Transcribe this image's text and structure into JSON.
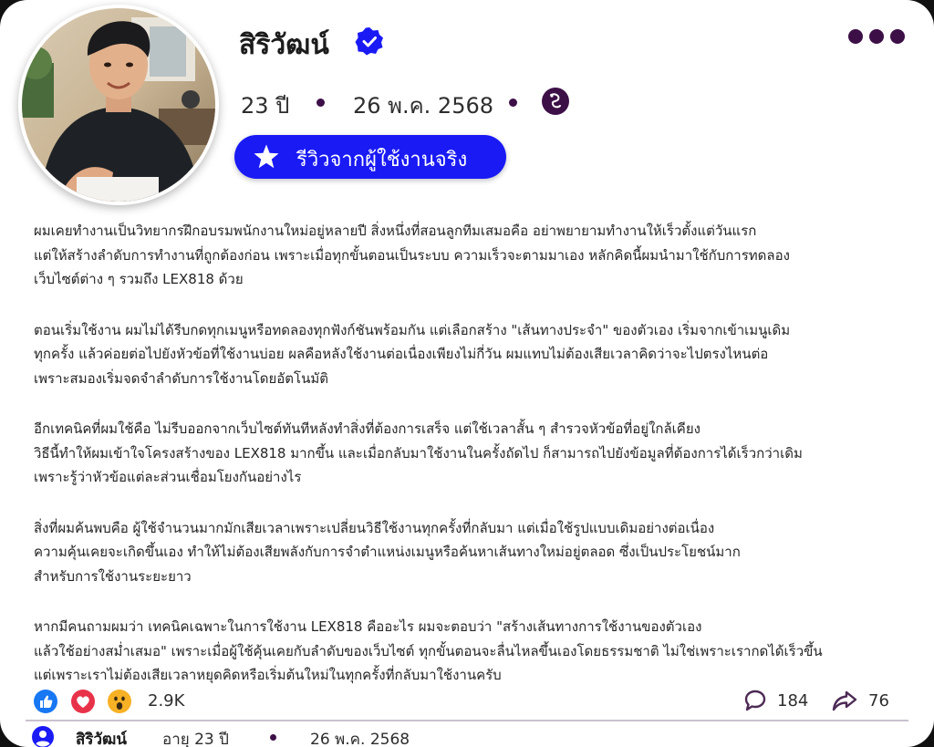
{
  "profile": {
    "name": "สิริวัฒน์",
    "verified_icon": "verified-badge-icon",
    "age": "23 ปี",
    "date": "26 พ.ค. 2568",
    "zodiac_icon": "zodiac-icon",
    "review_badge": "รีวิวจากผู้ใช้งานจริง"
  },
  "menu": {
    "icon": "more-options-icon"
  },
  "post": {
    "paragraphs": [
      "ผมเคยทำงานเป็นวิทยากรฝึกอบรมพนักงานใหม่อยู่หลายปี สิ่งหนึ่งที่สอนลูกทีมเสมอคือ อย่าพยายามทำงานให้เร็วตั้งแต่วันแรก\nแต่ให้สร้างลำดับการทำงานที่ถูกต้องก่อน เพราะเมื่อทุกขั้นตอนเป็นระบบ ความเร็วจะตามมาเอง หลักคิดนี้ผมนำมาใช้กับการทดลอง\nเว็บไซต์ต่าง ๆ รวมถึง LEX818 ด้วย",
      "ตอนเริ่มใช้งาน ผมไม่ได้รีบกดทุกเมนูหรือทดลองทุกฟังก์ชันพร้อมกัน แต่เลือกสร้าง \"เส้นทางประจำ\" ของตัวเอง เริ่มจากเข้าเมนูเดิม\nทุกครั้ง แล้วค่อยต่อไปยังหัวข้อที่ใช้งานบ่อย ผลคือหลังใช้งานต่อเนื่องเพียงไม่กี่วัน ผมแทบไม่ต้องเสียเวลาคิดว่าจะไปตรงไหนต่อ\nเพราะสมองเริ่มจดจำลำดับการใช้งานโดยอัตโนมัติ",
      "อีกเทคนิคที่ผมใช้คือ ไม่รีบออกจากเว็บไซต์ทันทีหลังทำสิ่งที่ต้องการเสร็จ แต่ใช้เวลาสั้น ๆ สำรวจหัวข้อที่อยู่ใกล้เคียง\nวิธีนี้ทำให้ผมเข้าใจโครงสร้างของ LEX818 มากขึ้น และเมื่อกลับมาใช้งานในครั้งถัดไป ก็สามารถไปยังข้อมูลที่ต้องการได้เร็วกว่าเดิม\nเพราะรู้ว่าหัวข้อแต่ละส่วนเชื่อมโยงกันอย่างไร",
      "สิ่งที่ผมค้นพบคือ ผู้ใช้จำนวนมากมักเสียเวลาเพราะเปลี่ยนวิธีใช้งานทุกครั้งที่กลับมา แต่เมื่อใช้รูปแบบเดิมอย่างต่อเนื่อง\nความคุ้นเคยจะเกิดขึ้นเอง ทำให้ไม่ต้องเสียพลังกับการจำตำแหน่งเมนูหรือค้นหาเส้นทางใหม่อยู่ตลอด ซึ่งเป็นประโยชน์มาก\nสำหรับการใช้งานระยะยาว",
      "หากมีคนถามผมว่า เทคนิคเฉพาะในการใช้งาน LEX818 คืออะไร ผมจะตอบว่า \"สร้างเส้นทางการใช้งานของตัวเอง\nแล้วใช้อย่างสม่ำเสมอ\" เพราะเมื่อผู้ใช้คุ้นเคยกับลำดับของเว็บไซต์ ทุกขั้นตอนจะลื่นไหลขึ้นเองโดยธรรมชาติ ไม่ใช่เพราะเรากดได้เร็วขึ้น\nแต่เพราะเราไม่ต้องเสียเวลาหยุดคิดหรือเริ่มต้นใหม่ในทุกครั้งที่กลับมาใช้งานครับ"
    ]
  },
  "engagement": {
    "reaction_icons": [
      "like-icon",
      "love-icon",
      "wow-icon"
    ],
    "reaction_count": "2.9K",
    "comment_icon": "comment-icon",
    "comment_count": "184",
    "share_icon": "share-icon",
    "share_count": "76"
  },
  "footer": {
    "user_icon": "user-icon",
    "name": "สิริวัฒน์",
    "age": "อายุ 23 ปี",
    "date": "26 พ.ค. 2568"
  },
  "colors": {
    "accent_blue": "#1a1af5",
    "dot_purple": "#3d0f47",
    "like_blue": "#1877f2",
    "love_red": "#e8324a",
    "wow_yellow": "#f7b125"
  }
}
